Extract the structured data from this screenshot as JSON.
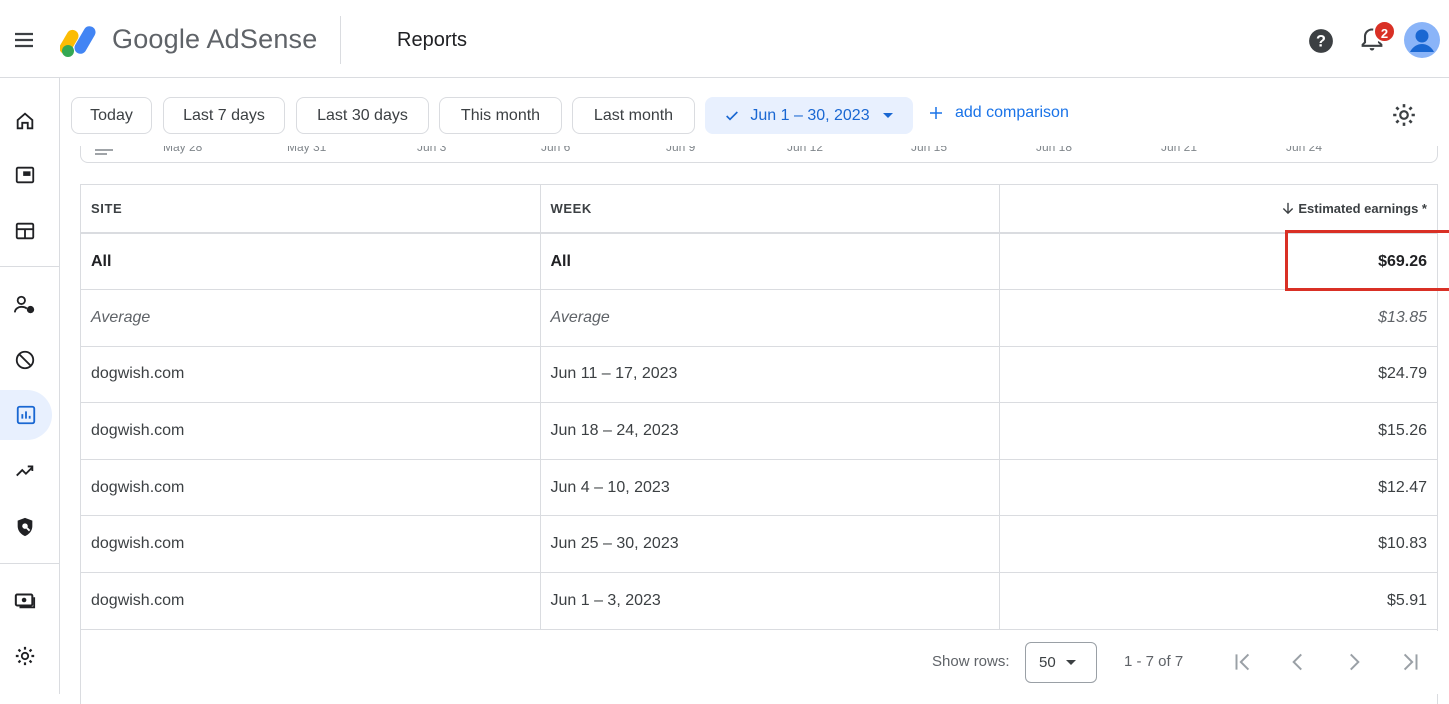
{
  "app": {
    "brand": "Google AdSense",
    "section": "Reports",
    "notification_count": "2"
  },
  "icons": {
    "menu": "menu-icon",
    "help": "help-icon",
    "notifications": "bell-icon",
    "account": "avatar-icon",
    "settings": "gear-icon"
  },
  "rail": {
    "items": [
      "home-icon",
      "overview-icon",
      "ads-icon",
      "account-icon",
      "blocking-icon",
      "reports-icon",
      "optimization-icon",
      "privacy-icon",
      "payments-icon",
      "settings-icon"
    ],
    "active": "reports-icon"
  },
  "filters": {
    "chips": [
      "Today",
      "Last 7 days",
      "Last 30 days",
      "This month",
      "Last month"
    ],
    "selected_range": "Jun 1 – 30, 2023",
    "add_comparison": "add comparison"
  },
  "chart_axis": {
    "ticks": [
      "May 28",
      "May 31",
      "Jun 3",
      "Jun 6",
      "Jun 9",
      "Jun 12",
      "Jun 15",
      "Jun 18",
      "Jun 21",
      "Jun 24"
    ]
  },
  "table": {
    "headers": {
      "site": "SITE",
      "week": "WEEK",
      "earnings": "Estimated earnings *"
    },
    "total": {
      "site": "All",
      "week": "All",
      "earnings": "$69.26"
    },
    "average": {
      "site": "Average",
      "week": "Average",
      "earnings": "$13.85"
    },
    "rows": [
      {
        "site": "dogwish.com",
        "week": "Jun 11 – 17, 2023",
        "earnings": "$24.79"
      },
      {
        "site": "dogwish.com",
        "week": "Jun 18 – 24, 2023",
        "earnings": "$15.26"
      },
      {
        "site": "dogwish.com",
        "week": "Jun 4 – 10, 2023",
        "earnings": "$12.47"
      },
      {
        "site": "dogwish.com",
        "week": "Jun 25 – 30, 2023",
        "earnings": "$10.83"
      },
      {
        "site": "dogwish.com",
        "week": "Jun 1 – 3, 2023",
        "earnings": "$5.91"
      }
    ]
  },
  "pagination": {
    "show_rows_label": "Show rows:",
    "rows_per_page": "50",
    "range": "1 - 7 of 7"
  },
  "colors": {
    "accent": "#1a73e8",
    "highlight": "#d93025",
    "badge": "#d93025"
  }
}
